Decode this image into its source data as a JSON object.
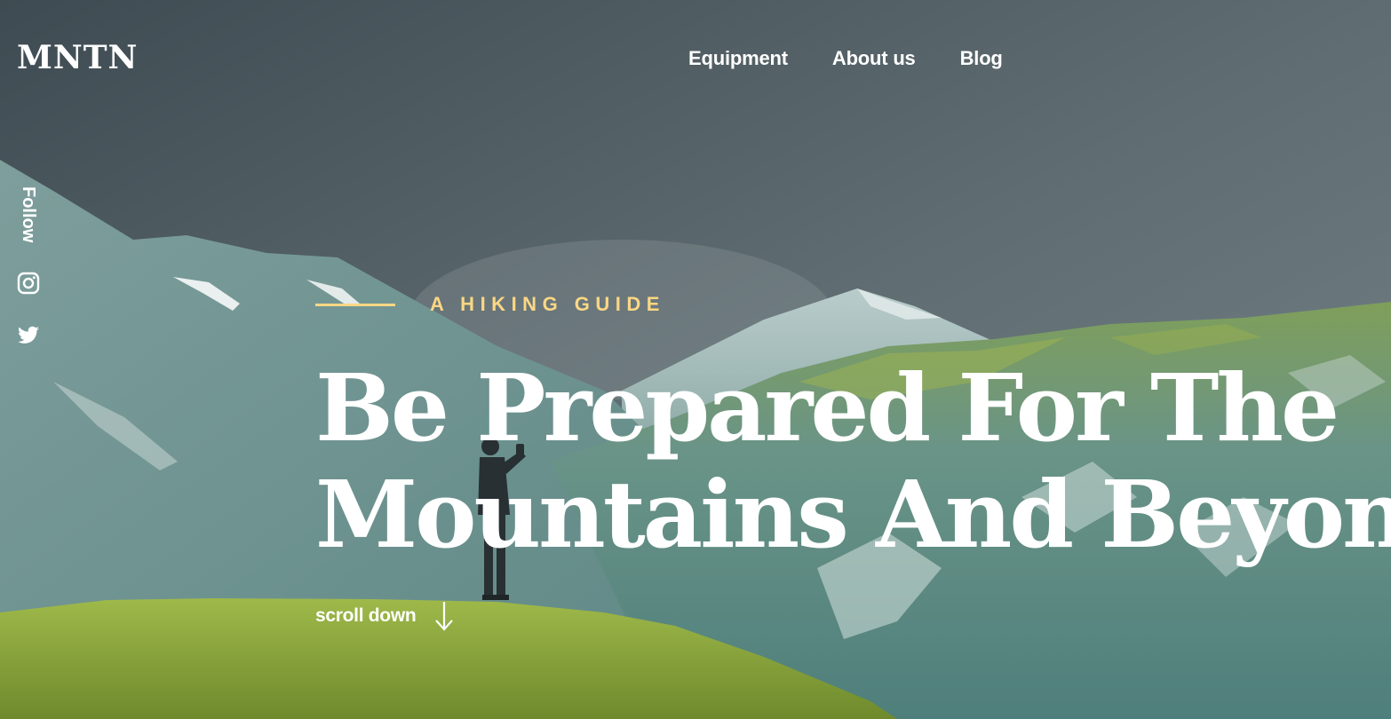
{
  "site": {
    "logo": "MNTN"
  },
  "nav": {
    "items": [
      {
        "label": "Equipment"
      },
      {
        "label": "About us"
      },
      {
        "label": "Blog"
      }
    ]
  },
  "social": {
    "follow_label": "Follow",
    "icons": [
      "instagram-icon",
      "twitter-icon"
    ]
  },
  "hero": {
    "eyebrow": "A HIKING GUIDE",
    "headline_line1": "Be Prepared For The",
    "headline_line2": "Mountains And Beyond!",
    "scroll_label": "scroll down"
  },
  "colors": {
    "accent": "#fbd784",
    "text": "#ffffff",
    "sky": "#4a575f",
    "mountain": "#6f9896",
    "grass": "#8faa3c"
  }
}
